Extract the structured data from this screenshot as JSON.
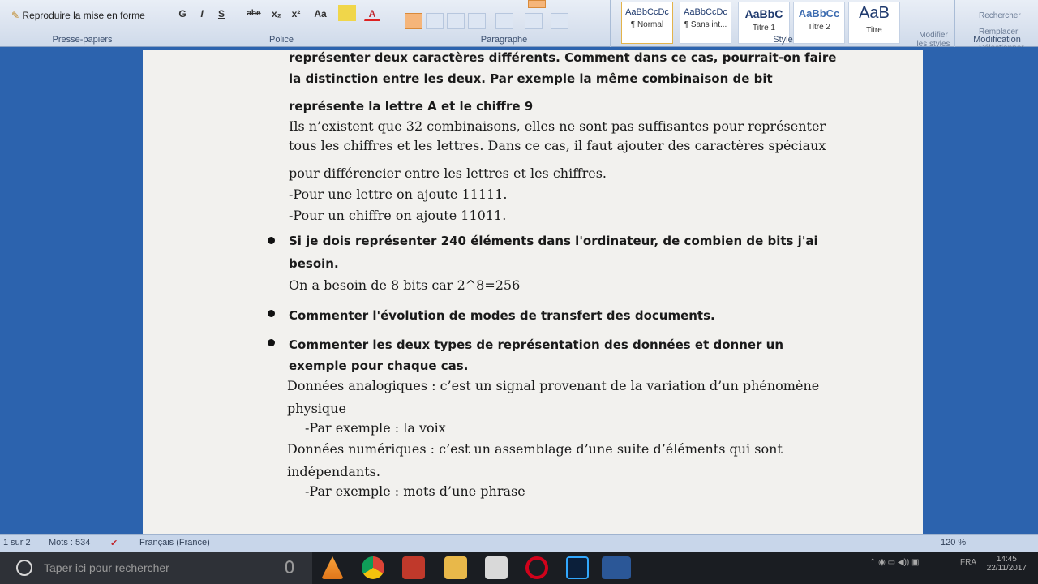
{
  "ribbon": {
    "clipboard": {
      "format_painter": "Reproduire la mise en forme",
      "label": "Presse-papiers"
    },
    "font": {
      "label": "Police",
      "buttons": [
        "G",
        "I",
        "S",
        "abe",
        "x₂",
        "x²",
        "Aa",
        "A"
      ]
    },
    "paragraph": {
      "label": "Paragraphe"
    },
    "styles": {
      "label": "Style",
      "tiles": [
        {
          "preview": "AaBbCcDc",
          "name": "¶ Normal"
        },
        {
          "preview": "AaBbCcDc",
          "name": "¶ Sans int..."
        },
        {
          "preview": "AaBbC",
          "name": "Titre 1"
        },
        {
          "preview": "AaBbCc",
          "name": "Titre 2"
        },
        {
          "preview": "AaB",
          "name": "Titre"
        }
      ],
      "modify": "Modifier les styles"
    },
    "editing": {
      "label": "Modification",
      "items": [
        "Rechercher",
        "Remplacer",
        "Sélectionner"
      ]
    }
  },
  "document": {
    "lines": [
      {
        "text": "représenter deux caractères différents. Comment dans ce cas, pourrait-on faire",
        "style": "bold"
      },
      {
        "text": "la distinction entre les deux. Par exemple la même combinaison de bit",
        "style": "bold"
      },
      {
        "text": "représente la lettre A et le chiffre 9",
        "style": "bold"
      },
      {
        "text": "Ils n’existent que 32 combinaisons, elles ne sont pas suffisantes pour représenter",
        "style": "reg"
      },
      {
        "text": "tous les chiffres et les lettres. Dans ce cas, il faut ajouter des caractères spéciaux",
        "style": "reg"
      },
      {
        "text": "pour différencier entre les lettres et les chiffres.",
        "style": "reg"
      },
      {
        "text": "-Pour une lettre on ajoute 11111.",
        "style": "reg"
      },
      {
        "text": "-Pour un chiffre on ajoute 11011.",
        "style": "reg"
      },
      {
        "text": "Si je dois représenter 240 éléments dans l'ordinateur, de combien de bits j'ai",
        "style": "bold"
      },
      {
        "text": "besoin.",
        "style": "bold"
      },
      {
        "text": "On a besoin de 8 bits car 2^8=256",
        "style": "reg"
      },
      {
        "text": "Commenter l'évolution de modes de transfert des documents.",
        "style": "bold"
      },
      {
        "text": "Commenter les deux types de représentation des données et donner un",
        "style": "bold"
      },
      {
        "text": "exemple pour chaque cas.",
        "style": "bold"
      },
      {
        "text": "Données analogiques : c’est un signal provenant de la variation d’un phénomène",
        "style": "reg"
      },
      {
        "text": "physique",
        "style": "reg"
      },
      {
        "text": "-Par exemple : la voix",
        "style": "reg"
      },
      {
        "text": "Données numériques : c’est un assemblage d’une suite d’éléments qui sont",
        "style": "reg"
      },
      {
        "text": "indépendants.",
        "style": "reg"
      },
      {
        "text": "-Par exemple : mots d’une phrase",
        "style": "reg"
      }
    ]
  },
  "status": {
    "page": "1 sur 2",
    "words": "Mots : 534",
    "language": "Français (France)",
    "zoom": "120 %"
  },
  "taskbar": {
    "search_placeholder": "Taper ici pour rechercher",
    "lang": "FRA",
    "time": "14:45",
    "date": "22/11/2017"
  }
}
